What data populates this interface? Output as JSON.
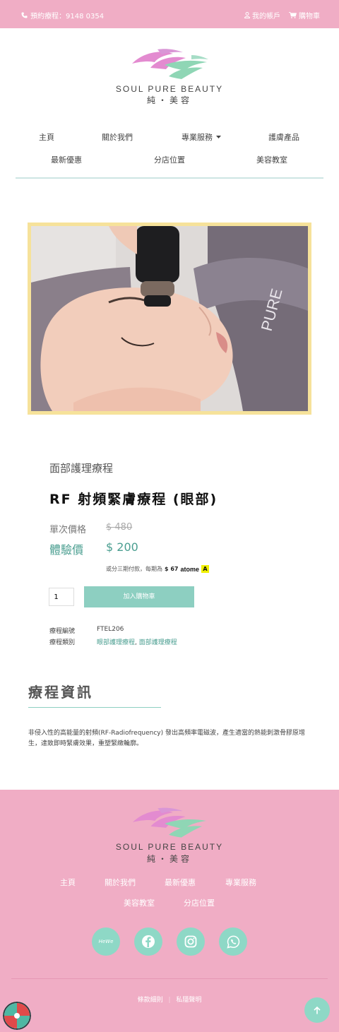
{
  "topbar": {
    "phone": "預約療程：9148 0354",
    "account": "我的帳戶",
    "cart": "購物車",
    "phone_icon": "phone-icon",
    "user_icon": "user-icon",
    "cart_icon": "cart-icon"
  },
  "brand": {
    "name": "SOUL PURE BEAUTY",
    "sub": "純・美容",
    "colors": {
      "pink": "#f0adc5",
      "mint": "#8dcfc1",
      "yellow": "#f6e29a"
    }
  },
  "nav": {
    "items": [
      "主頁",
      "關於我們",
      "專業服務",
      "護膚產品",
      "最新優惠",
      "分店位置",
      "美容教室"
    ]
  },
  "product": {
    "category": "面部護理療程",
    "title": "RF 射頻緊膚療程 (眼部)",
    "single_price_label": "單次價格",
    "single_price": "$ 480",
    "trial_label": "體驗價",
    "trial_price": "$ 200",
    "installment_prefix": "或分三期付款，每期為",
    "installment_amount": "$ 67",
    "installment_brand": "atome",
    "quantity": "1",
    "add_to_cart": "加入購物車",
    "code_label": "療程編號",
    "code": "FTEL206",
    "type_label": "療程類別",
    "type_link1": "眼部護理療程",
    "type_sep": ", ",
    "type_link2": "面部護理療程"
  },
  "info": {
    "heading": "療程資訊",
    "body": "非侵入性的高能量的射頻(RF-Radiofrequency) 發出高頻率電磁波，產生適當的熱能刺激骨膠原增生，達致即時緊膚效果，重塑緊緻輪廓。"
  },
  "footer": {
    "brand": "SOUL PURE BEAUTY",
    "sub": "純・美容",
    "nav": [
      "主頁",
      "關於我們",
      "最新優惠",
      "專業服務",
      "美容教室",
      "分店位置"
    ],
    "social": [
      "HeWe",
      "facebook-icon",
      "instagram-icon",
      "whatsapp-icon"
    ],
    "hewe_label": "HeWe",
    "terms": "條款細則",
    "privacy": "私隱聲明",
    "sep": "|"
  }
}
